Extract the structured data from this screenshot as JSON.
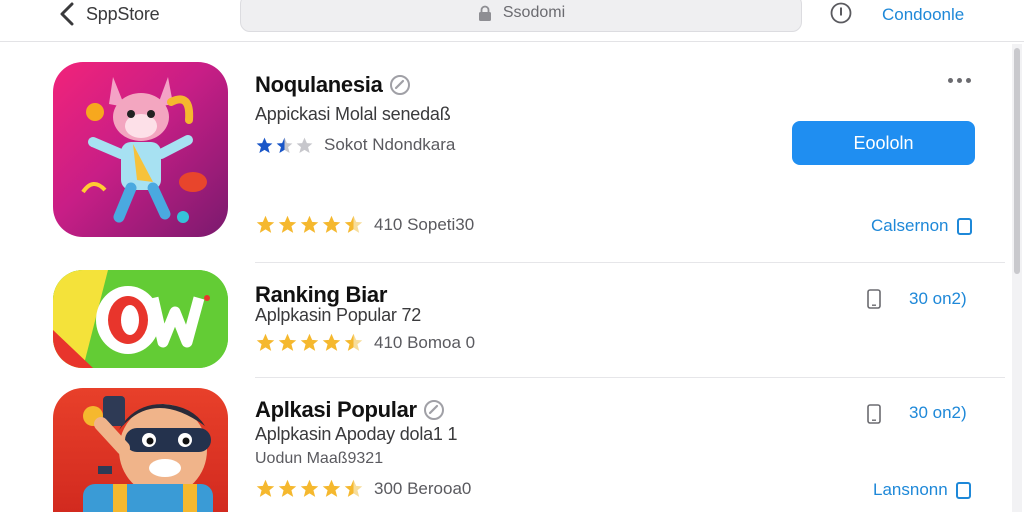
{
  "header": {
    "back_label": "SppStore",
    "search_text": "Ssodomi",
    "right_link": "Condoonle"
  },
  "apps": [
    {
      "title": "Noqulanesia",
      "subtitle": "Appickasi Molal senedaß",
      "rating_text": "Sokot Ndondkara",
      "rating_stars": 1.5,
      "reviews": "410 Sopeti30",
      "review_stars": 4.5,
      "action_label": "Eoololn",
      "link_label": "Calsernon"
    },
    {
      "title": "Ranking Biar",
      "subtitle": "Aplpkasin Popular 72",
      "reviews": "410 Bomoa 0",
      "review_stars": 4.5,
      "price": "30 on2)"
    },
    {
      "title": "Aplkasi Popular",
      "subtitle": "Aplpkasin Apoday dola1 1",
      "extra": "Uodun Maaß9321",
      "reviews": "300 Berooa0",
      "review_stars": 4.5,
      "price": "30 on2)",
      "link_label": "Lansnonn"
    }
  ],
  "colors": {
    "accent": "#1f8ef1",
    "link": "#1e88d8",
    "star_gold": "#f5b82e",
    "star_blue": "#1a56c8"
  }
}
